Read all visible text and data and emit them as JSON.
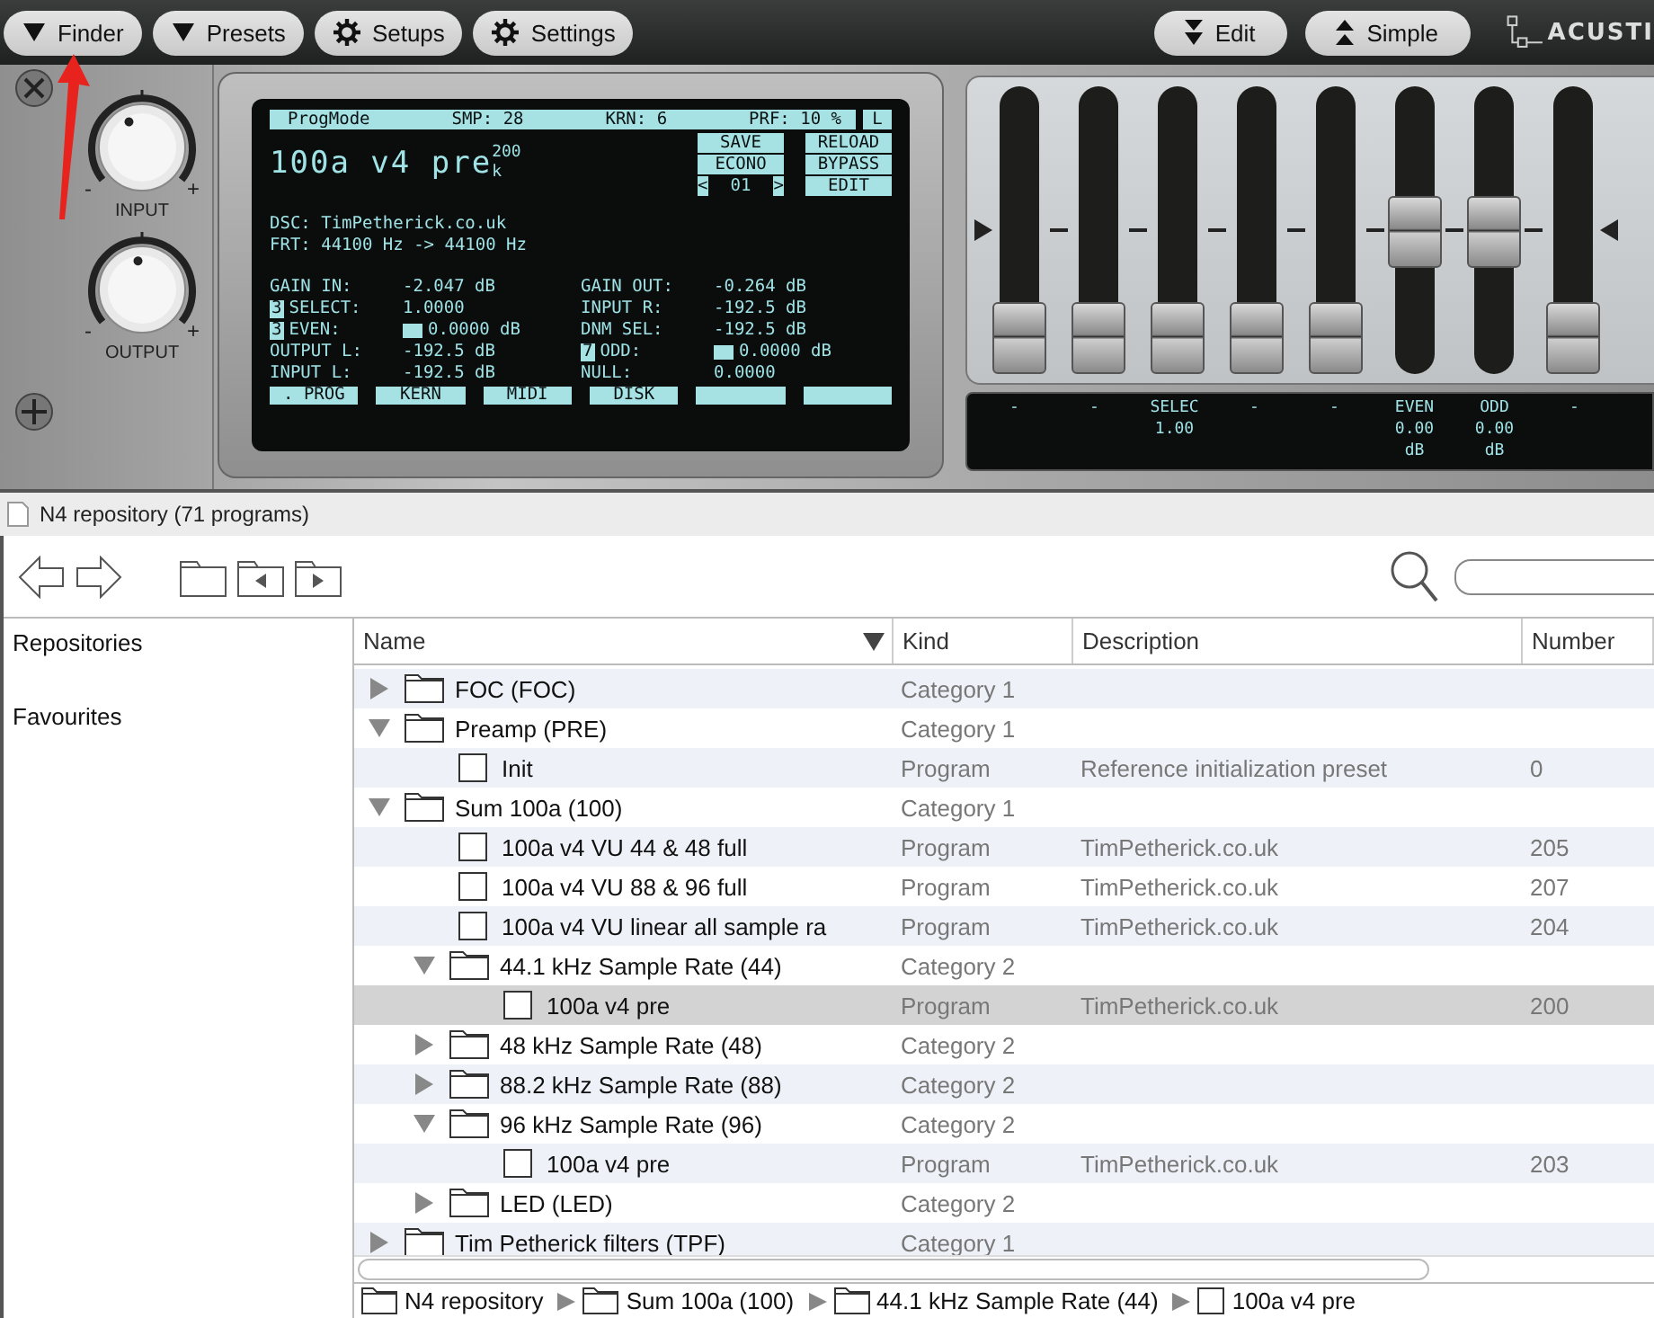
{
  "toolbar": {
    "buttons": [
      {
        "label": "Finder"
      },
      {
        "label": "Presets"
      },
      {
        "label": "Setups"
      },
      {
        "label": "Settings"
      }
    ],
    "right_buttons": [
      {
        "label": "Edit"
      },
      {
        "label": "Simple"
      }
    ],
    "logo": "ACUSTI"
  },
  "plugin": {
    "knobs": [
      {
        "label": "INPUT",
        "minus": "-",
        "plus": "+",
        "level": 0.4
      },
      {
        "label": "OUTPUT",
        "minus": "-",
        "plus": "+",
        "level": 0.47
      }
    ],
    "lcd": {
      "status": [
        "ProgMode",
        "SMP: 28",
        "KRN: 6",
        "PRF: 10 %"
      ],
      "channel": "L",
      "title": "100a v4 pre",
      "title_sup": "200",
      "title_sub": "k",
      "buttons": [
        "SAVE",
        "RELOAD",
        "ECONO",
        "BYPASS"
      ],
      "pager": {
        "prev": "<",
        "value": "01",
        "next": ">"
      },
      "edit_button": "EDIT",
      "info": [
        "DSC: TimPetherick.co.uk",
        "FRT: 44100 Hz -> 44100 Hz"
      ],
      "params_left": [
        {
          "label": "GAIN IN:",
          "value": "-2.047 dB"
        },
        {
          "marker": "3",
          "label": "SELECT:",
          "value": "1.0000"
        },
        {
          "marker": "3",
          "label": "EVEN:",
          "value": "0.0000 dB",
          "meter": true
        },
        {
          "label": "OUTPUT L:",
          "value": "-192.5 dB"
        },
        {
          "label": "INPUT L:",
          "value": "-192.5 dB"
        }
      ],
      "params_right": [
        {
          "label": "GAIN OUT:",
          "value": "-0.264 dB"
        },
        {
          "label": "INPUT R:",
          "value": "-192.5 dB"
        },
        {
          "label": "DNM SEL:",
          "value": "-192.5 dB"
        },
        {
          "marker": "7",
          "label": "ODD:",
          "value": "0.0000 dB",
          "meter": true
        },
        {
          "label": "NULL:",
          "value": "0.0000"
        }
      ],
      "tabs": [
        ". PROG",
        "KERN",
        "MIDI",
        "DISK"
      ]
    },
    "faders": [
      {
        "label": "-",
        "level": 0
      },
      {
        "label": "-",
        "level": 0
      },
      {
        "label": "SELEC",
        "value": "1.00",
        "level": 0
      },
      {
        "label": "-",
        "level": 0
      },
      {
        "label": "-",
        "level": 0
      },
      {
        "label": "EVEN",
        "value": "0.00",
        "unit": "dB",
        "level": 0.5
      },
      {
        "label": "ODD",
        "value": "0.00",
        "unit": "dB",
        "level": 0.5
      },
      {
        "label": "-",
        "level": 0
      }
    ]
  },
  "browser": {
    "title": "N4 repository (71 programs)",
    "sidebar": [
      "Repositories",
      "Favourites"
    ],
    "columns": [
      "Name",
      "Kind",
      "Description",
      "Number"
    ],
    "rows": [
      {
        "name": "FOC (FOC)",
        "kind": "folder",
        "type": "Category 1",
        "expanded": false,
        "selected": false
      },
      {
        "name": "Preamp (PRE)",
        "kind": "folder",
        "type": "Category 1",
        "expanded": true,
        "selected": false,
        "children": [
          {
            "name": "Init",
            "kind": "file",
            "type": "Program",
            "description": "Reference initialization preset",
            "number": "0",
            "selected": false
          }
        ]
      },
      {
        "name": "Sum 100a (100)",
        "kind": "folder",
        "type": "Category 1",
        "expanded": true,
        "selected": false,
        "children": [
          {
            "name": "100a v4 VU 44 & 48 full",
            "kind": "file",
            "type": "Program",
            "description": "TimPetherick.co.uk",
            "number": "205",
            "selected": false
          },
          {
            "name": "100a v4 VU 88 & 96 full",
            "kind": "file",
            "type": "Program",
            "description": "TimPetherick.co.uk",
            "number": "207",
            "selected": false
          },
          {
            "name": "100a v4 VU linear all sample ra",
            "kind": "file",
            "type": "Program",
            "description": "TimPetherick.co.uk",
            "number": "204",
            "selected": false
          },
          {
            "name": "44.1 kHz Sample Rate (44)",
            "kind": "folder",
            "type": "Category 2",
            "expanded": true,
            "selected": false,
            "children": [
              {
                "name": "100a v4 pre",
                "kind": "file",
                "type": "Program",
                "description": "TimPetherick.co.uk",
                "number": "200",
                "selected": true
              }
            ]
          },
          {
            "name": "48 kHz Sample Rate (48)",
            "kind": "folder",
            "type": "Category 2",
            "expanded": false,
            "selected": false
          },
          {
            "name": "88.2 kHz Sample Rate (88)",
            "kind": "folder",
            "type": "Category 2",
            "expanded": false,
            "selected": false
          },
          {
            "name": "96 kHz Sample Rate (96)",
            "kind": "folder",
            "type": "Category 2",
            "expanded": true,
            "selected": false,
            "children": [
              {
                "name": "100a v4 pre",
                "kind": "file",
                "type": "Program",
                "description": "TimPetherick.co.uk",
                "number": "203",
                "selected": false
              }
            ]
          },
          {
            "name": "LED (LED)",
            "kind": "folder",
            "type": "Category 2",
            "expanded": false,
            "selected": false
          }
        ]
      },
      {
        "name": "Tim Petherick filters (TPF)",
        "kind": "folder",
        "type": "Category 1",
        "expanded": false,
        "selected": false
      }
    ],
    "breadcrumb": [
      {
        "label": "N4 repository",
        "kind": "folder"
      },
      {
        "label": "Sum 100a (100)",
        "kind": "folder"
      },
      {
        "label": "44.1 kHz Sample Rate (44)",
        "kind": "folder"
      },
      {
        "label": "100a v4 pre",
        "kind": "file"
      }
    ]
  }
}
